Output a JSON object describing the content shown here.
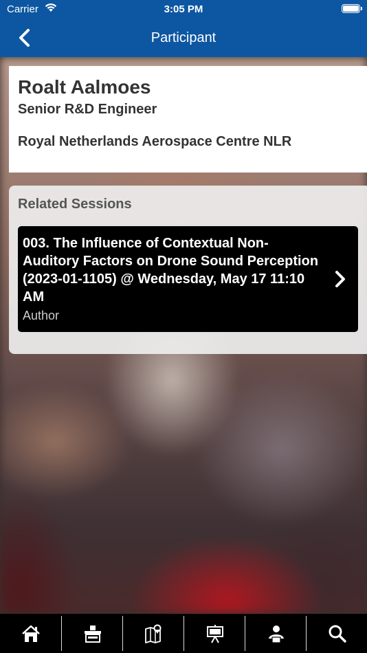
{
  "status_bar": {
    "carrier": "Carrier",
    "time": "3:05 PM"
  },
  "nav": {
    "title": "Participant"
  },
  "participant": {
    "name": "Roalt Aalmoes",
    "title": "Senior R&D Engineer",
    "organization": "Royal Netherlands Aerospace Centre NLR"
  },
  "related_sessions": {
    "heading": "Related Sessions",
    "items": [
      {
        "title": "003. The Influence of Contextual Non-Auditory Factors on Drone Sound Perception (2023-01-1105) @ Wednesday, May 17 11:10 AM",
        "role": "Author"
      }
    ]
  },
  "tabs": [
    {
      "icon": "home-icon"
    },
    {
      "icon": "exhibitor-booth-icon"
    },
    {
      "icon": "map-icon"
    },
    {
      "icon": "presentation-icon"
    },
    {
      "icon": "speaker-icon"
    },
    {
      "icon": "search-icon"
    }
  ],
  "colors": {
    "nav_bar": "#0d57a2",
    "tab_bar": "#000000",
    "session_card": "#000000"
  }
}
